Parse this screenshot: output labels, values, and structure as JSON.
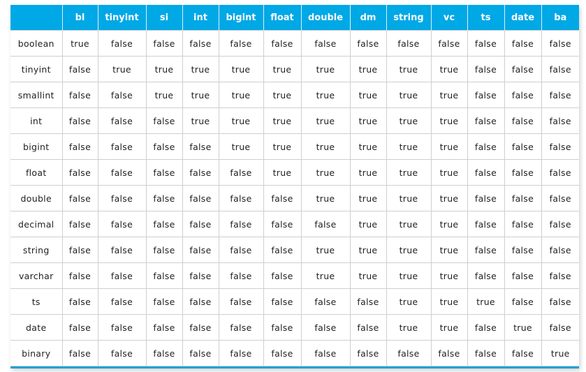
{
  "table": {
    "header_color": "#00a8e6",
    "columns": [
      "",
      "bl",
      "tinyint",
      "si",
      "int",
      "bigint",
      "float",
      "double",
      "dm",
      "string",
      "vc",
      "ts",
      "date",
      "ba"
    ],
    "rows": [
      {
        "label": "boolean",
        "cells": [
          "true",
          "false",
          "false",
          "false",
          "false",
          "false",
          "false",
          "false",
          "false",
          "false",
          "false",
          "false",
          "false"
        ]
      },
      {
        "label": "tinyint",
        "cells": [
          "false",
          "true",
          "true",
          "true",
          "true",
          "true",
          "true",
          "true",
          "true",
          "true",
          "false",
          "false",
          "false"
        ]
      },
      {
        "label": "smallint",
        "cells": [
          "false",
          "false",
          "true",
          "true",
          "true",
          "true",
          "true",
          "true",
          "true",
          "true",
          "false",
          "false",
          "false"
        ]
      },
      {
        "label": "int",
        "cells": [
          "false",
          "false",
          "false",
          "true",
          "true",
          "true",
          "true",
          "true",
          "true",
          "true",
          "false",
          "false",
          "false"
        ]
      },
      {
        "label": "bigint",
        "cells": [
          "false",
          "false",
          "false",
          "false",
          "true",
          "true",
          "true",
          "true",
          "true",
          "true",
          "false",
          "false",
          "false"
        ]
      },
      {
        "label": "float",
        "cells": [
          "false",
          "false",
          "false",
          "false",
          "false",
          "true",
          "true",
          "true",
          "true",
          "true",
          "false",
          "false",
          "false"
        ]
      },
      {
        "label": "double",
        "cells": [
          "false",
          "false",
          "false",
          "false",
          "false",
          "false",
          "true",
          "true",
          "true",
          "true",
          "false",
          "false",
          "false"
        ]
      },
      {
        "label": "decimal",
        "cells": [
          "false",
          "false",
          "false",
          "false",
          "false",
          "false",
          "false",
          "true",
          "true",
          "true",
          "false",
          "false",
          "false"
        ]
      },
      {
        "label": "string",
        "cells": [
          "false",
          "false",
          "false",
          "false",
          "false",
          "false",
          "true",
          "true",
          "true",
          "true",
          "false",
          "false",
          "false"
        ]
      },
      {
        "label": "varchar",
        "cells": [
          "false",
          "false",
          "false",
          "false",
          "false",
          "false",
          "true",
          "true",
          "true",
          "true",
          "false",
          "false",
          "false"
        ]
      },
      {
        "label": "ts",
        "cells": [
          "false",
          "false",
          "false",
          "false",
          "false",
          "false",
          "false",
          "false",
          "true",
          "true",
          "true",
          "false",
          "false"
        ]
      },
      {
        "label": "date",
        "cells": [
          "false",
          "false",
          "false",
          "false",
          "false",
          "false",
          "false",
          "false",
          "true",
          "true",
          "false",
          "true",
          "false"
        ]
      },
      {
        "label": "binary",
        "cells": [
          "false",
          "false",
          "false",
          "false",
          "false",
          "false",
          "false",
          "false",
          "false",
          "false",
          "false",
          "false",
          "true"
        ]
      }
    ]
  }
}
